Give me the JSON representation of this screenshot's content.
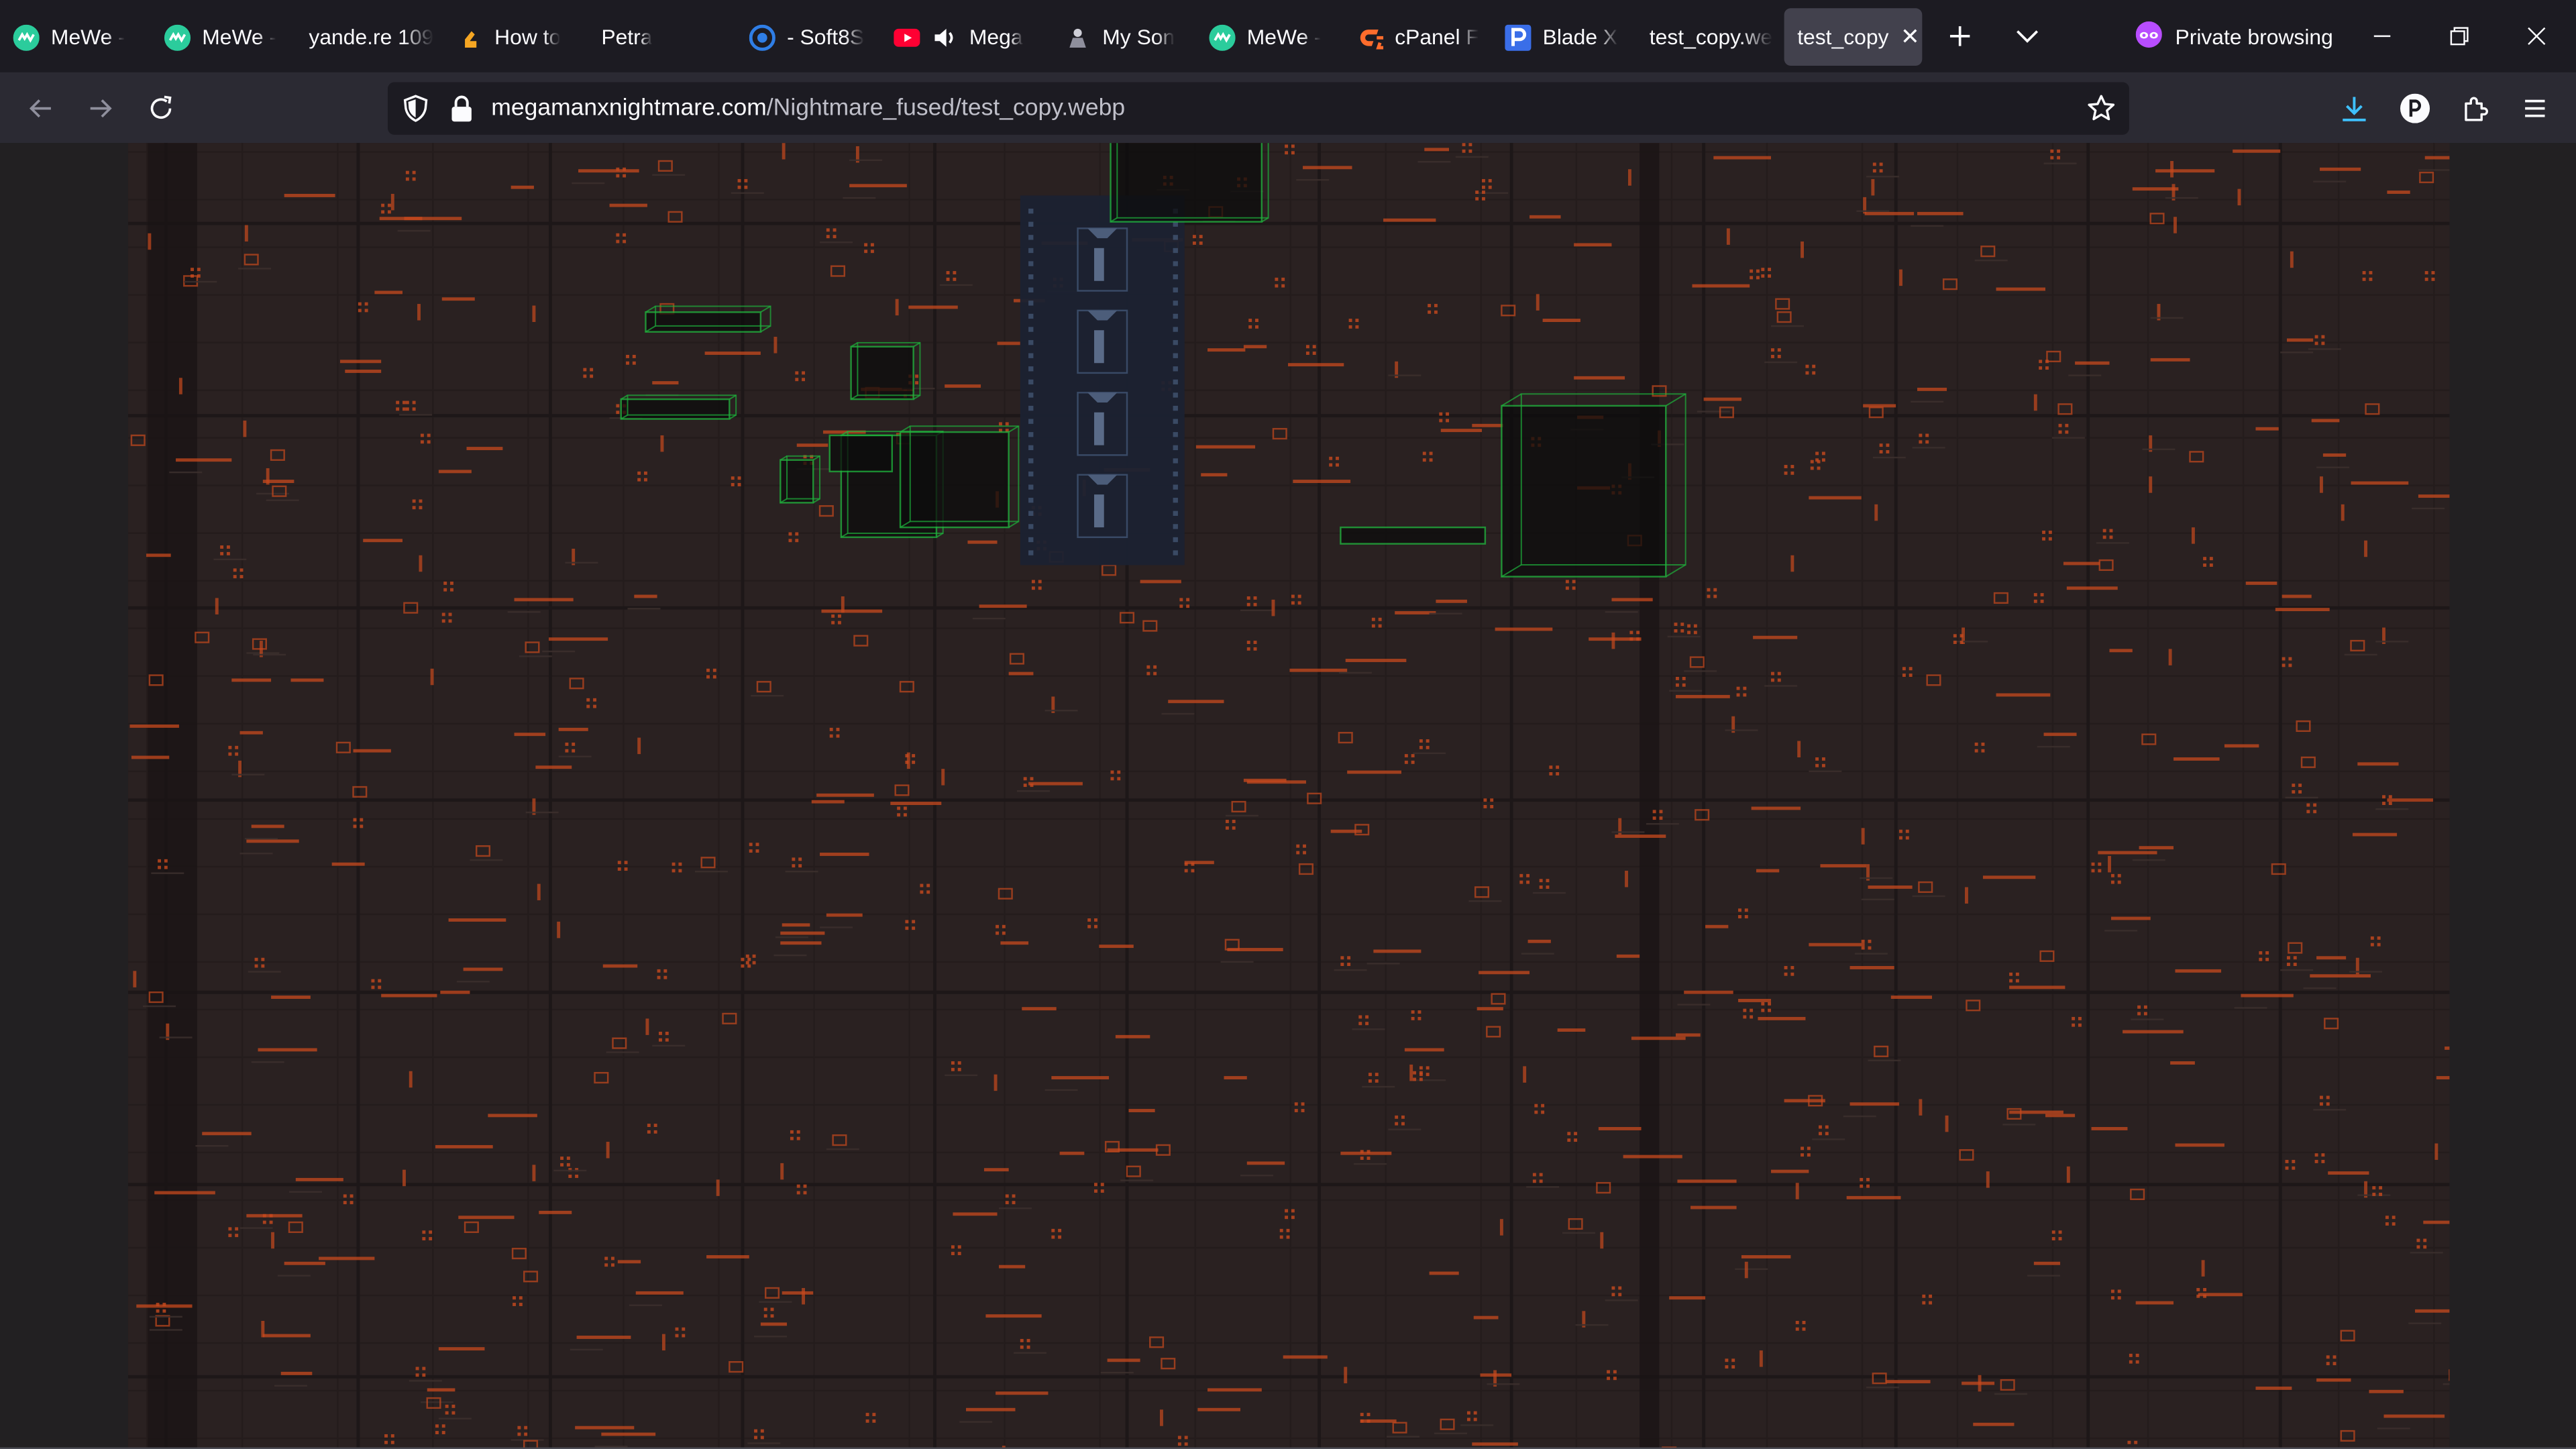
{
  "tabs": [
    {
      "label": "MeWe -",
      "icon": "mewe-icon",
      "active": false
    },
    {
      "label": "MeWe -",
      "icon": "mewe-icon",
      "active": false
    },
    {
      "label": "yande.re 109",
      "icon": "",
      "active": false
    },
    {
      "label": "How to",
      "icon": "instructables-icon",
      "active": false
    },
    {
      "label": "Petra",
      "icon": "",
      "active": false
    },
    {
      "label": "- Soft8S",
      "icon": "soft-icon",
      "active": false
    },
    {
      "label": "Mega",
      "icon": "youtube-icon",
      "active": false,
      "audio": true
    },
    {
      "label": "My Son",
      "icon": "robot-icon",
      "active": false
    },
    {
      "label": "MeWe -",
      "icon": "mewe-icon",
      "active": false
    },
    {
      "label": "cPanel F",
      "icon": "cpanel-icon",
      "active": false
    },
    {
      "label": "Blade X",
      "icon": "p-icon",
      "active": false
    },
    {
      "label": "test_copy.we",
      "icon": "",
      "active": false
    },
    {
      "label": "test_copy",
      "icon": "",
      "active": true
    }
  ],
  "private_label": "Private browsing",
  "url": {
    "host": "megamanxnightmare.com",
    "path": "/Nightmare_fused/test_copy.webp"
  },
  "colors": {
    "mewe": "#2bcc9c",
    "youtube": "#ff0033",
    "cpanel": "#ff6c2c",
    "p_blue": "#3a6ee8",
    "soft_blue": "#2f7ee6",
    "private_purple": "#b84dff",
    "download_blue": "#3fc1ff",
    "instructables": "#f5a623"
  },
  "image_content": {
    "orange_mark_color": "#c84a1e",
    "wire_green": "#1eb43c",
    "panel_blue": "#1b2232"
  }
}
